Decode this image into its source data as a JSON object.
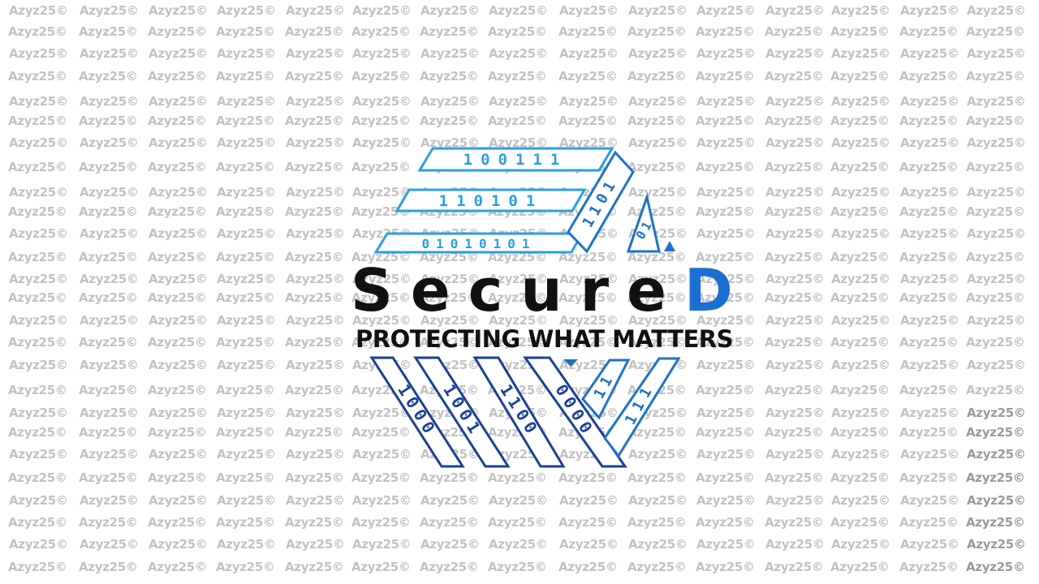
{
  "watermark": {
    "text": "Azyz25©"
  },
  "logo": {
    "wordmark_main": "Secure",
    "wordmark_accent": "D",
    "tagline": "PROTECTING WHAT MATTERS",
    "colors": {
      "dark_text": "#111111",
      "accent": "#1a6fd0",
      "light_blue": "#2a9fe0",
      "mid_blue": "#1e72c8",
      "dark_blue": "#1c3f96"
    },
    "binary_strips_top": [
      "100111",
      "110101",
      "01010101"
    ],
    "binary_strips_right": [
      "1101",
      "01"
    ],
    "binary_strips_bottom": [
      "1000",
      "1001",
      "1100",
      "0000",
      "11",
      "111"
    ]
  }
}
